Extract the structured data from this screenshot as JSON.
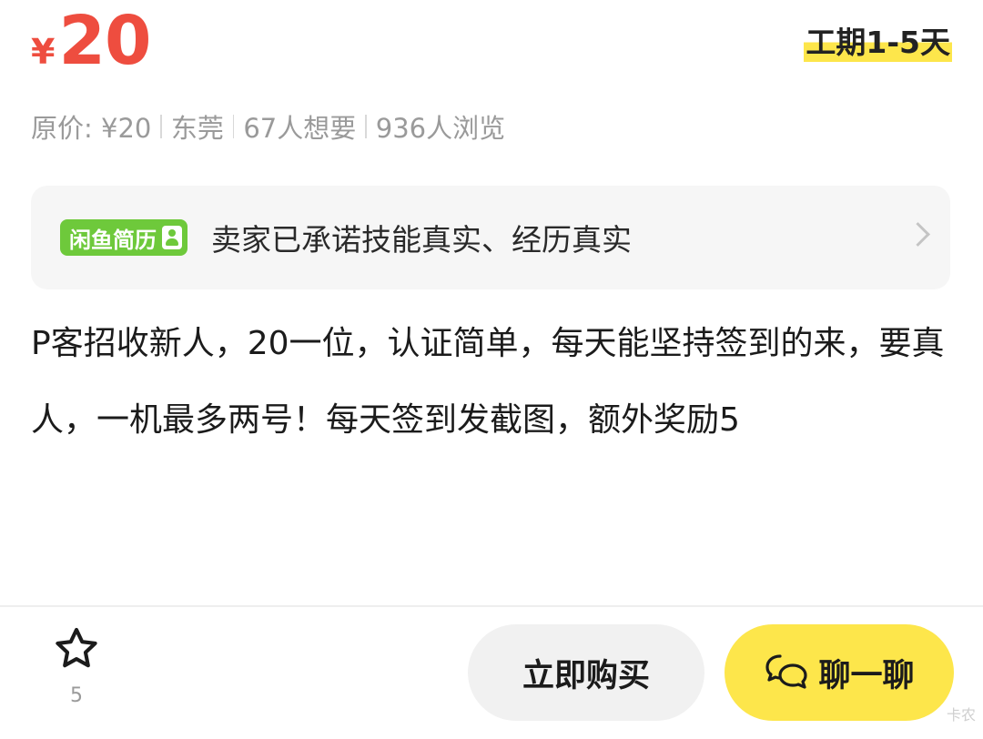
{
  "price": {
    "currency_symbol": "¥",
    "amount": "20"
  },
  "work_period": "工期1-5天",
  "meta": [
    "原价: ¥20",
    "东莞",
    "67人想要",
    "936人浏览"
  ],
  "banner": {
    "badge_label": "闲鱼简历",
    "text": "卖家已承诺技能真实、经历真实"
  },
  "description": "P客招收新人，20一位，认证简单，每天能坚持签到的来，要真人，一机最多两号！每天签到发截图，额外奖励5",
  "bottom_bar": {
    "favorite_count": "5",
    "buy_label": "立即购买",
    "chat_label": "聊一聊"
  },
  "watermark": "卡农",
  "colors": {
    "price": "#ee4d3f",
    "accent_yellow": "#fde64b",
    "badge_green": "#6ec93b"
  },
  "icons": {
    "favorite": "star-outline-icon",
    "chat": "chat-bubbles-icon",
    "banner_arrow": "chevron-right-icon"
  }
}
